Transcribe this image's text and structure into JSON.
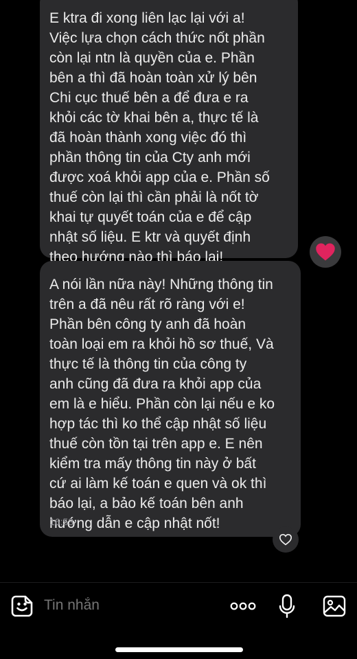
{
  "thread": {
    "messages": [
      {
        "text": "E ktra đi xong liên lạc lại với a!\nViệc lựa chọn cách thức nốt phần\ncòn lại ntn là quyền của e. Phần\nbên a thì đã hoàn toàn xử lý bên\nChi cục thuế bên a để đưa e ra\nkhỏi các tờ khai bên a, thực tế là\nđã hoàn thành xong việc đó thì\nphần thông tin của Cty anh mới\nđược xoá khỏi app của e. Phần số\nthuế còn lại thì cần phải là nốt tờ\nkhai tự quyết toán của e để cập\nnhật số liệu. E ktr và quyết định\ntheo hướng nào thì báo lại!",
        "reaction_icon": "red-heart-icon"
      },
      {
        "text": "A nói lần nữa này! Những thông tin\ntrên a đã nêu rất rõ ràng với e!\nPhần bên công ty anh đã hoàn\ntoàn loại em ra khỏi hồ sơ thuế, Và\nthực tế là thông tin của công ty\nanh cũng đã đưa ra khỏi app của\nem là e hiểu. Phần còn lại nếu e ko\nhợp tác thì ko thể cập nhật số liệu\nthuế còn tồn tại trên app e. E nên\nkiểm tra mấy thông tin này ở bất\ncứ ai làm kế toán e quen và ok thì\nbáo lại, a bảo kế toán bên anh\nhướng dẫn e cập nhật nốt!",
        "time": "16:53",
        "react_icon": "heart-outline-icon"
      }
    ]
  },
  "composer": {
    "placeholder": "Tin nhắn",
    "icons": [
      "sticker-icon",
      "more-icon",
      "microphone-icon",
      "image-icon"
    ]
  },
  "colors": {
    "background": "#000000",
    "bubble": "#2b2b2d",
    "text": "#ececec",
    "muted": "#8e8e93",
    "heart": "#e0245e"
  }
}
